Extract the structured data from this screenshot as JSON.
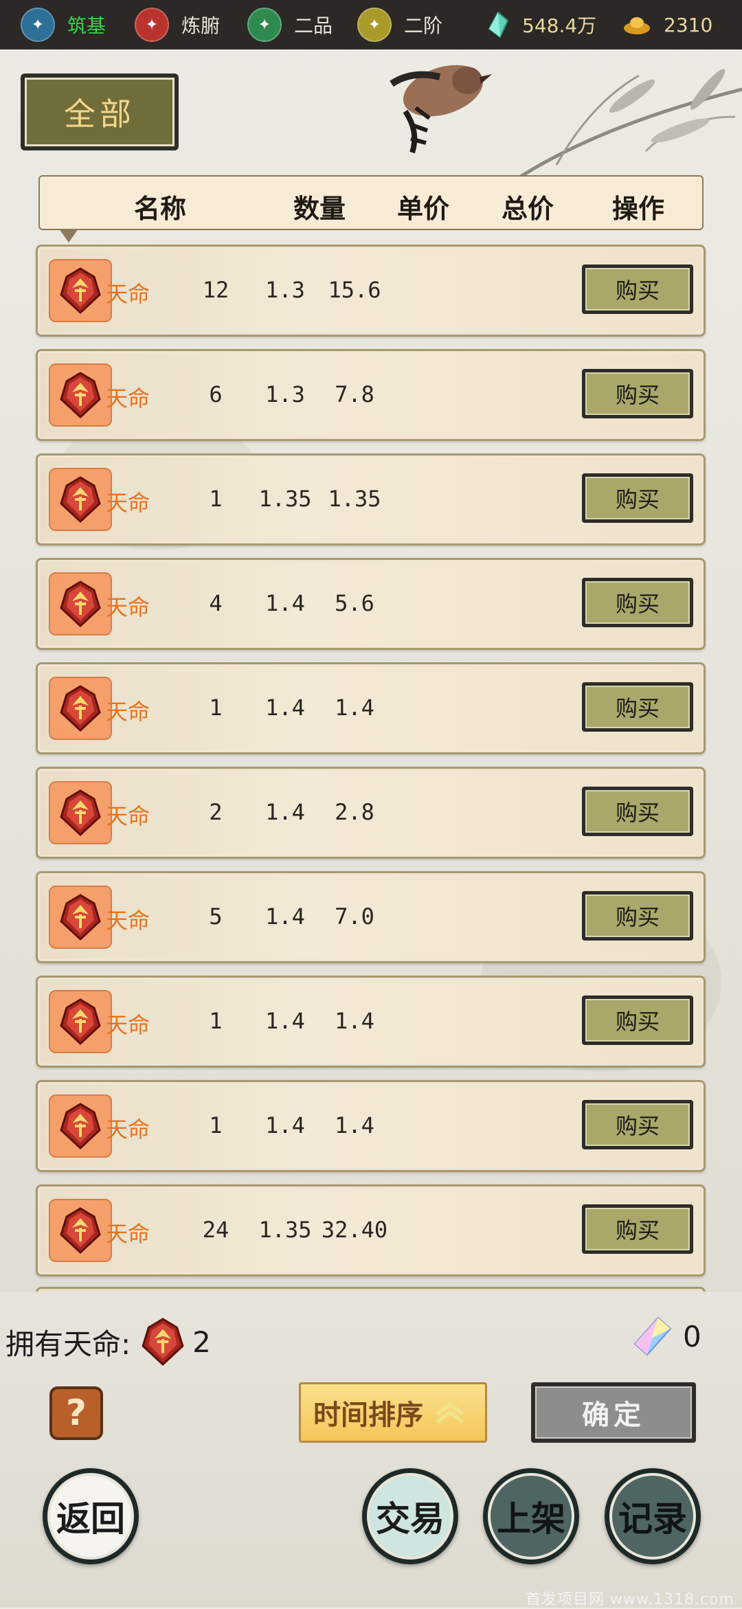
{
  "status_bar": {
    "realm": "筑基",
    "body": "炼腑",
    "grade": "二品",
    "stage": "二阶",
    "crystal_amount": "548.4万",
    "gold_amount": "2310"
  },
  "category_tab": {
    "label": "全部"
  },
  "columns": [
    "名称",
    "数量",
    "单价",
    "总价",
    "操作"
  ],
  "rows": [
    {
      "name": "天命",
      "qty": "12",
      "unit_price": "1.3",
      "total": "15.6",
      "action": "购买"
    },
    {
      "name": "天命",
      "qty": "6",
      "unit_price": "1.3",
      "total": "7.8",
      "action": "购买"
    },
    {
      "name": "天命",
      "qty": "1",
      "unit_price": "1.35",
      "total": "1.35",
      "action": "购买"
    },
    {
      "name": "天命",
      "qty": "4",
      "unit_price": "1.4",
      "total": "5.6",
      "action": "购买"
    },
    {
      "name": "天命",
      "qty": "1",
      "unit_price": "1.4",
      "total": "1.4",
      "action": "购买"
    },
    {
      "name": "天命",
      "qty": "2",
      "unit_price": "1.4",
      "total": "2.8",
      "action": "购买"
    },
    {
      "name": "天命",
      "qty": "5",
      "unit_price": "1.4",
      "total": "7.0",
      "action": "购买"
    },
    {
      "name": "天命",
      "qty": "1",
      "unit_price": "1.4",
      "total": "1.4",
      "action": "购买"
    },
    {
      "name": "天命",
      "qty": "1",
      "unit_price": "1.4",
      "total": "1.4",
      "action": "购买"
    },
    {
      "name": "天命",
      "qty": "24",
      "unit_price": "1.35",
      "total": "32.40",
      "action": "购买"
    }
  ],
  "owned": {
    "label": "拥有天命:",
    "count": "2"
  },
  "crystal_owned": "0",
  "sort_button": "时间排序",
  "confirm_button": "确定",
  "help_symbol": "?",
  "nav": {
    "back": "返回",
    "trade": "交易",
    "list": "上架",
    "records": "记录"
  },
  "watermark": "首发项目网 www.1318.com",
  "icons": {
    "realm": "blue-emblem-icon",
    "body": "red-emblem-icon",
    "grade": "green-emblem-icon",
    "stage": "yellow-emblem-icon",
    "crystal": "jade-crystal-icon",
    "gold": "gold-ingot-icon",
    "item": "tianming-token-icon"
  },
  "colors": {
    "status_bg": "#2b2825",
    "realm_green": "#39d24b",
    "item_name": "#e6741f",
    "button_olive": "#a9a86a",
    "sort_gold": "#f4c659"
  }
}
